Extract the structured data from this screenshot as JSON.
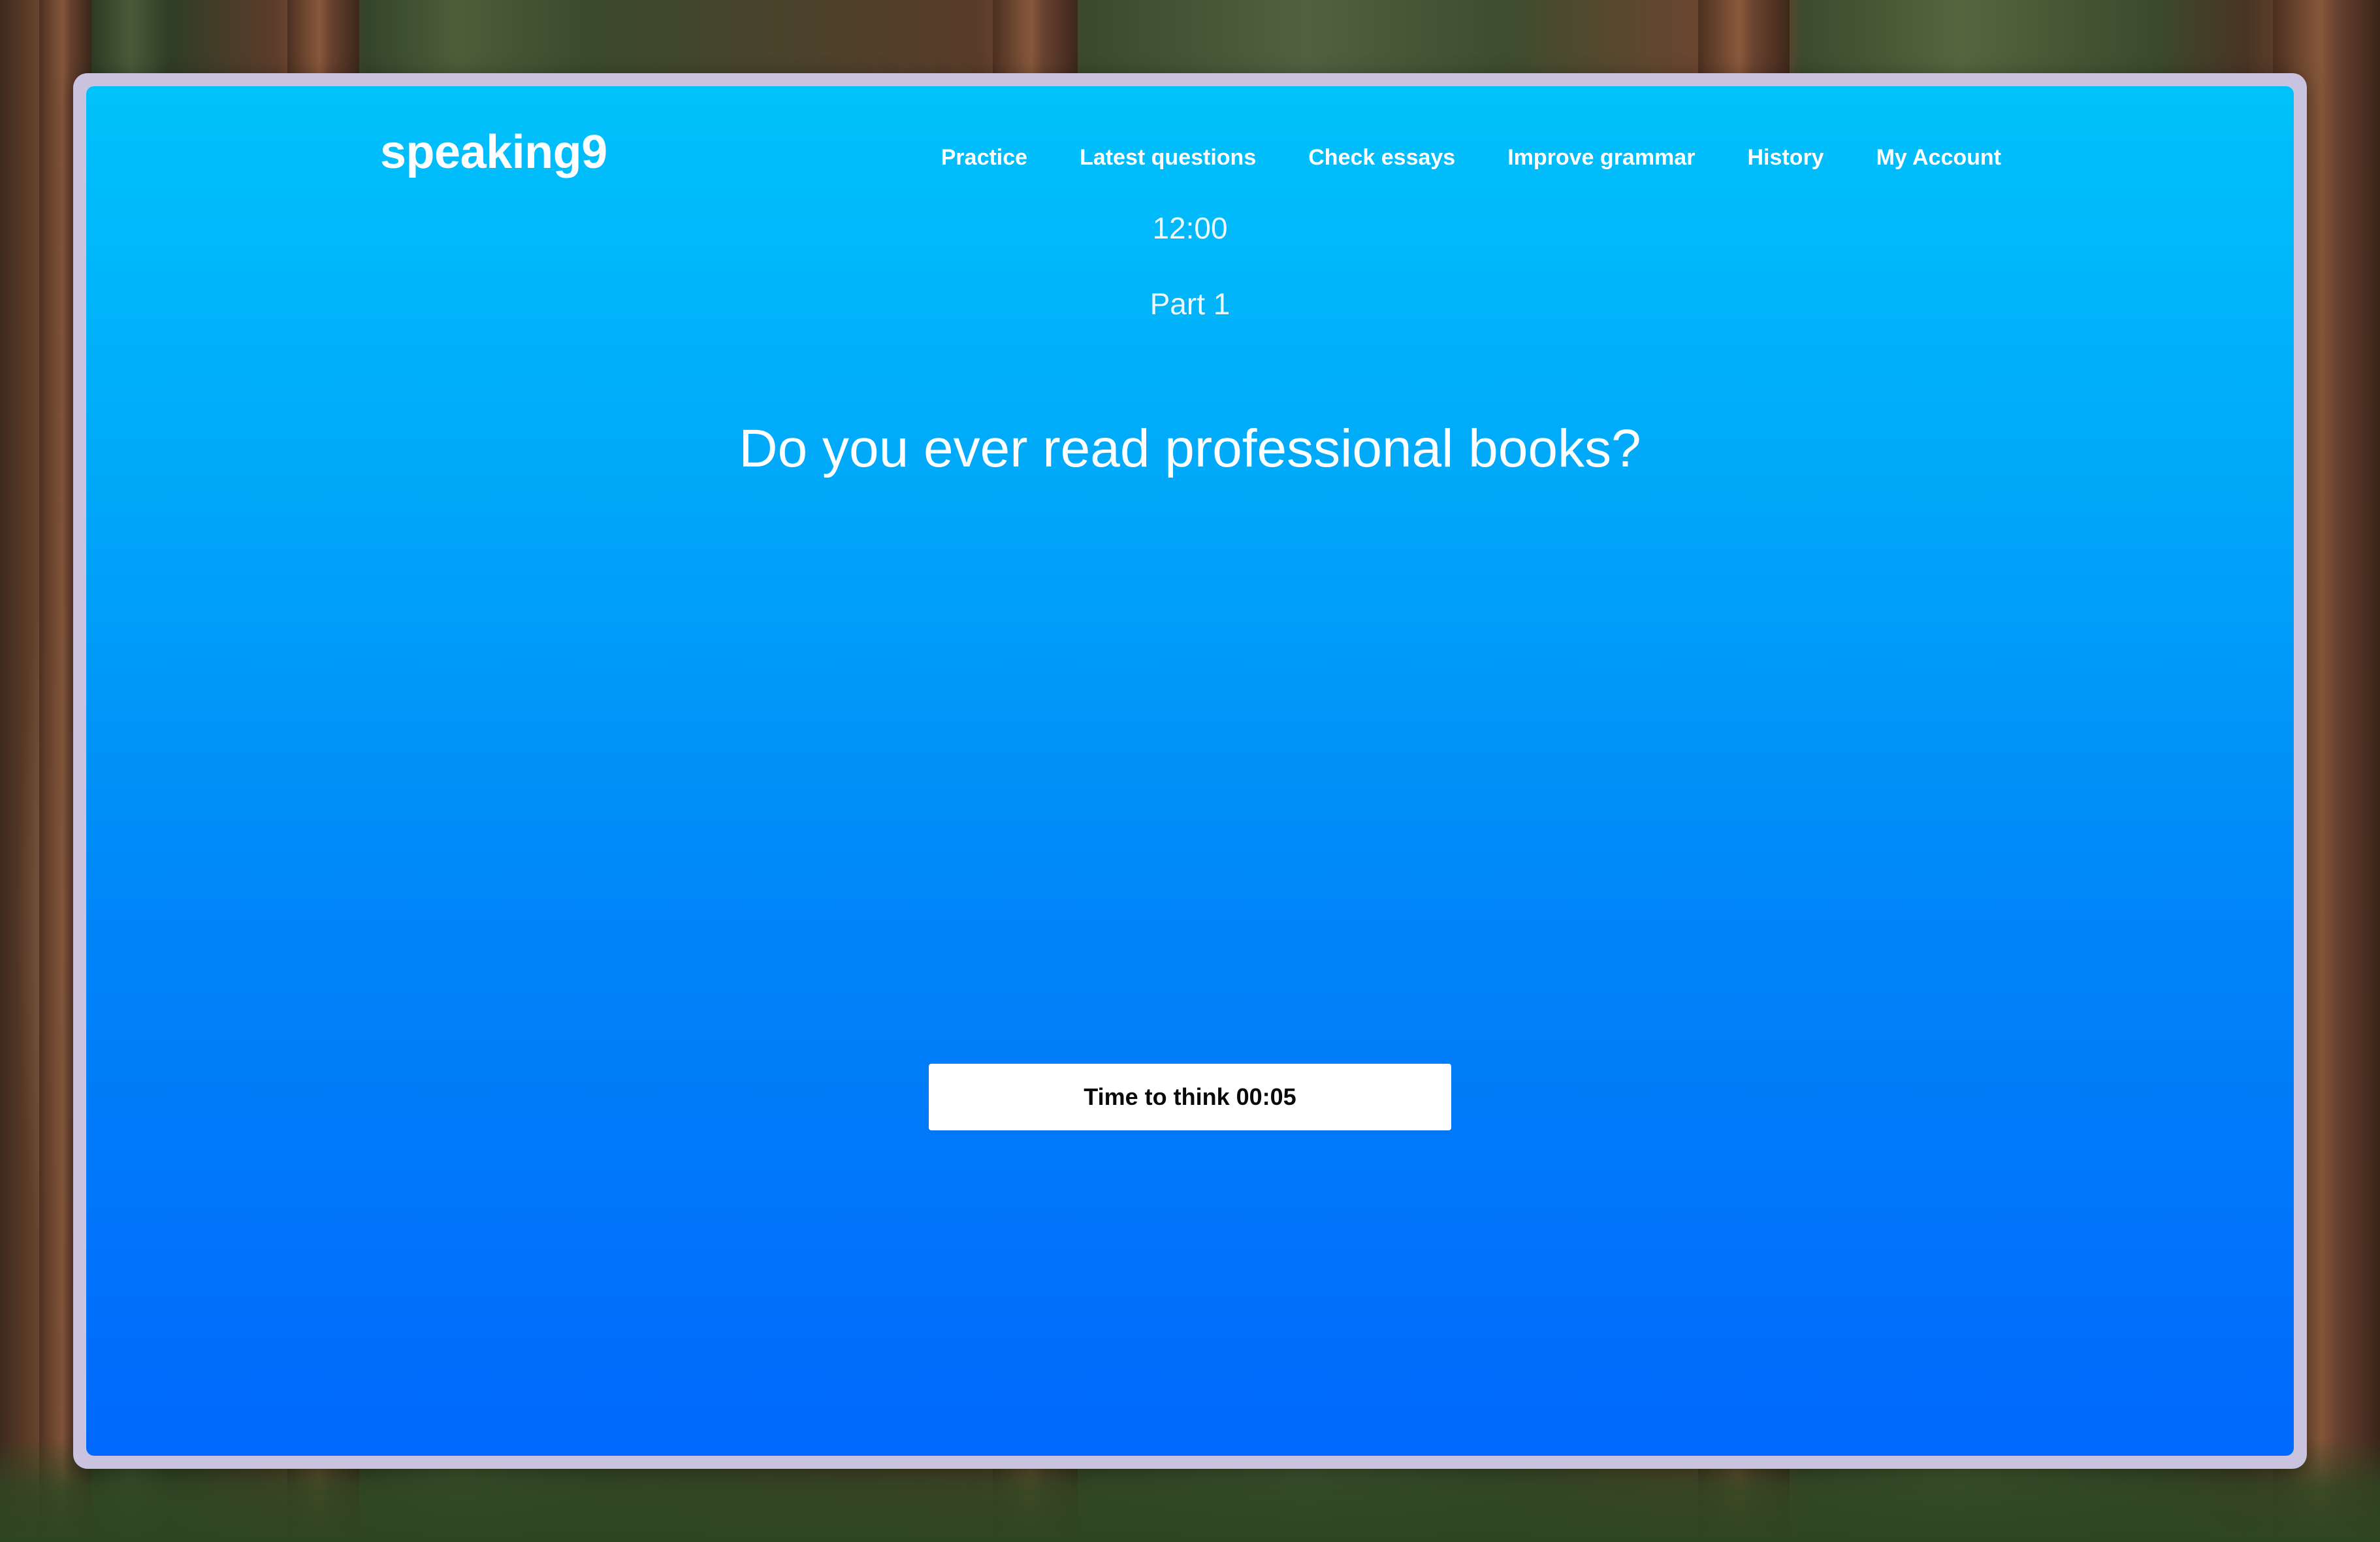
{
  "app": {
    "logo": "speaking9"
  },
  "nav": {
    "items": [
      {
        "label": "Practice"
      },
      {
        "label": "Latest questions"
      },
      {
        "label": "Check essays"
      },
      {
        "label": "Improve grammar"
      },
      {
        "label": "History"
      },
      {
        "label": "My Account"
      }
    ]
  },
  "session": {
    "timer": "12:00",
    "part": "Part 1",
    "question": "Do you ever read professional books?",
    "think_button_label": "Time to think 00:05"
  },
  "colors": {
    "gradient_top": "#00c2fb",
    "gradient_bottom": "#0068fc",
    "window_frame": "#c9c3e0",
    "button_bg": "#ffffff",
    "text": "#ffffff"
  }
}
